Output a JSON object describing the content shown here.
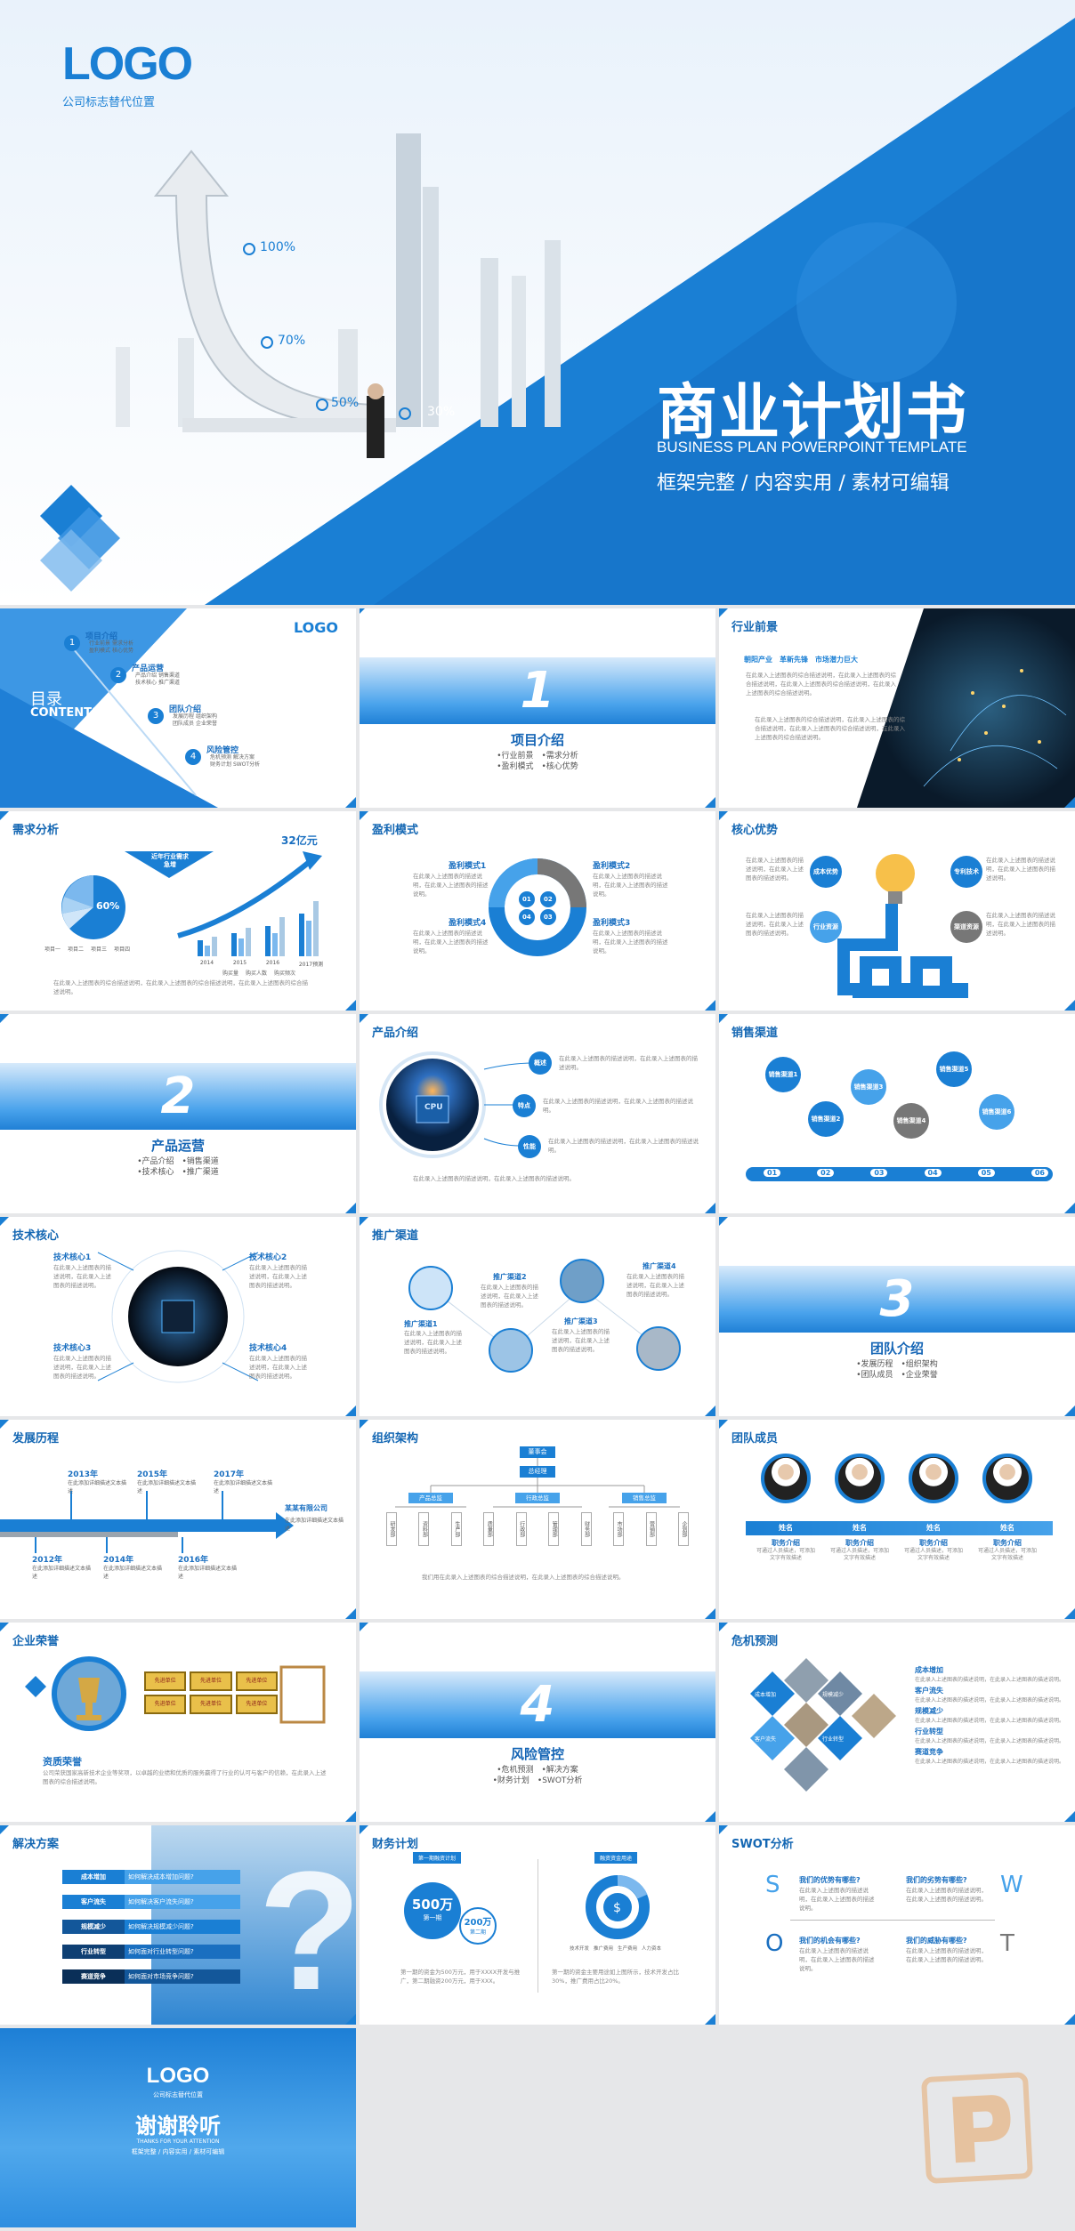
{
  "cover": {
    "logo": "LOGO",
    "logo_sub": "公司标志替代位置",
    "title": "商业计划书",
    "subtitle": "BUSINESS PLAN POWERPOINT TEMPLATE",
    "tagline": "框架完整 / 内容实用 / 素材可编辑",
    "pcts": [
      "100%",
      "70%",
      "50%",
      "30%"
    ]
  },
  "toc": {
    "logo": "LOGO",
    "title": "目录",
    "title_en": "CONTENTS",
    "items": [
      {
        "n": "1",
        "name": "项目介绍",
        "subs": [
          "行业前景",
          "需求分析",
          "盈利模式",
          "核心优势"
        ]
      },
      {
        "n": "2",
        "name": "产品运营",
        "subs": [
          "产品介绍",
          "销售渠道",
          "技术核心",
          "推广渠道"
        ]
      },
      {
        "n": "3",
        "name": "团队介绍",
        "subs": [
          "发展历程",
          "组织架构",
          "团队成员",
          "企业荣誉"
        ]
      },
      {
        "n": "4",
        "name": "风险管控",
        "subs": [
          "危机预测",
          "解决方案",
          "财务计划",
          "SWOT分析"
        ]
      }
    ]
  },
  "chapters": [
    {
      "num": "1",
      "title": "项目介绍",
      "lines": [
        "•行业前景　•需求分析",
        "•盈利模式　•核心优势"
      ]
    },
    {
      "num": "2",
      "title": "产品运营",
      "lines": [
        "•产品介绍　•销售渠道",
        "•技术核心　•推广渠道"
      ]
    },
    {
      "num": "3",
      "title": "团队介绍",
      "lines": [
        "•发展历程　•组织架构",
        "•团队成员　•企业荣誉"
      ]
    },
    {
      "num": "4",
      "title": "风险管控",
      "lines": [
        "•危机预测　•解决方案",
        "•财务计划　•SWOT分析"
      ]
    }
  ],
  "industry": {
    "title": "行业前景",
    "headline": "朝阳产业　革新先锋　市场潜力巨大",
    "para": "在此录入上述图表的综合描述说明，在此录入上述图表的综合描述说明，在此录入上述图表的综合描述说明，在此录入上述图表的综合描述说明。"
  },
  "demand": {
    "title": "需求分析",
    "banner": "近年行业需求急增",
    "big": "32亿元",
    "pie_pct": "60%",
    "years": [
      "2014",
      "2015",
      "2016",
      "2017预测"
    ],
    "legend": [
      "项目一",
      "项目二",
      "项目三",
      "项目四"
    ],
    "bar_legend": [
      "购买量",
      "购买人数",
      "购买频次"
    ],
    "para": "在此录入上述图表的综合描述说明，在此录入上述图表的综合描述说明，在此录入上述图表的综合描述说明。"
  },
  "profit": {
    "title": "盈利模式",
    "modes": [
      "盈利模式1",
      "盈利模式2",
      "盈利模式3",
      "盈利模式4"
    ],
    "nums": [
      "01",
      "02",
      "03",
      "04"
    ],
    "desc": "在此录入上述图表的描述说明，在此录入上述图表的描述说明。"
  },
  "core": {
    "title": "核心优势",
    "tags": [
      "成本优势",
      "专利技术",
      "行业资源",
      "渠道资源"
    ],
    "desc": "在此录入上述图表的描述说明，在此录入上述图表的描述说明。"
  },
  "product": {
    "title": "产品介绍",
    "tags": [
      "概述",
      "特点",
      "性能"
    ],
    "cpu": "CPU",
    "desc": "在此录入上述图表的描述说明，在此录入上述图表的描述说明。"
  },
  "sales": {
    "title": "销售渠道",
    "pins": [
      "销售渠道1",
      "销售渠道2",
      "销售渠道3",
      "销售渠道4",
      "销售渠道5",
      "销售渠道6"
    ],
    "nums": [
      "01",
      "02",
      "03",
      "04",
      "05",
      "06"
    ]
  },
  "tech": {
    "title": "技术核心",
    "items": [
      "技术核心1",
      "技术核心2",
      "技术核心3",
      "技术核心4"
    ],
    "desc": "在此录入上述图表的描述说明，在此录入上述图表的描述说明。"
  },
  "promo": {
    "title": "推广渠道",
    "items": [
      "推广渠道1",
      "推广渠道2",
      "推广渠道3",
      "推广渠道4"
    ],
    "desc": "在此录入上述图表的描述说明，在此录入上述图表的描述说明。"
  },
  "history": {
    "title": "发展历程",
    "years_top": [
      "2013年",
      "2015年",
      "2017年"
    ],
    "years_bottom": [
      "2012年",
      "2014年",
      "2016年"
    ],
    "company": "某某有限公司",
    "desc": "在此添加详细描述文本描述"
  },
  "org": {
    "title": "组织架构",
    "top": "董事会",
    "mgr": "总经理",
    "centers": [
      "产品总监",
      "行政总监",
      "销售总监"
    ],
    "depts": [
      "研发部",
      "资料部",
      "生产部",
      "质量部",
      "行政部",
      "管理部",
      "财务部",
      "市场部",
      "营销部",
      "企划部"
    ],
    "desc": "我们用在此录入上述图表的综合描述说明，在此录入上述图表的综合描述说明。"
  },
  "team": {
    "title": "团队成员",
    "names": [
      "姓名",
      "姓名",
      "姓名",
      "姓名"
    ],
    "role": "职务介绍",
    "desc": "可通过人员描述，可添加文字有效描述"
  },
  "honor": {
    "title": "企业荣誉",
    "cert": "先进单位",
    "label": "资质荣誉",
    "para": "公司荣获国家高新技术企业等奖项，以卓越的业绩和优质的服务赢得了行业的认可与客户的信赖，在此录入上述图表的综合描述说明。"
  },
  "crisis": {
    "title": "危机预测",
    "tags": [
      "成本增加",
      "客户流失",
      "规模减少",
      "行业转型"
    ],
    "items": [
      "成本增加",
      "客户流失",
      "规模减少",
      "行业转型",
      "赛道竞争"
    ],
    "desc": "在此录入上述图表的描述说明，在此录入上述图表的描述说明。"
  },
  "solution": {
    "title": "解决方案",
    "tags": [
      "成本增加",
      "客户流失",
      "规模减少",
      "行业转型",
      "赛道竞争"
    ],
    "questions": [
      "如何解决成本增加问题?",
      "如何解决客户流失问题?",
      "如何解决规模减少问题?",
      "如何面对行业转型问题?",
      "如何面对市场竞争问题?"
    ],
    "q": "?"
  },
  "finance": {
    "title": "财务计划",
    "tag1": "第一期融资计划",
    "tag2": "融资资金用途",
    "amt1": "500万",
    "amt1_sub": "第一期",
    "amt2": "200万",
    "amt2_sub": "第二期",
    "legend": [
      "技术开发",
      "推广费用",
      "生产费用",
      "人力资本"
    ],
    "p1": "第一期的资金为500万元，用于XXXX开发与推广，第二期融资200万元，用于XXX。",
    "p2": "第一期的资金主要用途如上图所示，技术开发占比30%，推广费用占比20%。"
  },
  "swot": {
    "title": "SWOT分析",
    "letters": [
      "S",
      "W",
      "O",
      "T"
    ],
    "qs": [
      "我们的优势有哪些?",
      "我们的劣势有哪些?",
      "我们的机会有哪些?",
      "我们的威胁有哪些?"
    ],
    "desc": "在此录入上述图表的描述说明，在此录入上述图表的描述说明。"
  },
  "end": {
    "logo": "LOGO",
    "logo_sub": "公司标志替代位置",
    "title": "谢谢聆听",
    "sub": "THANKS FOR YOUR ATTENTION",
    "tagline": "框架完整 / 内容实用 / 素材可编辑"
  }
}
